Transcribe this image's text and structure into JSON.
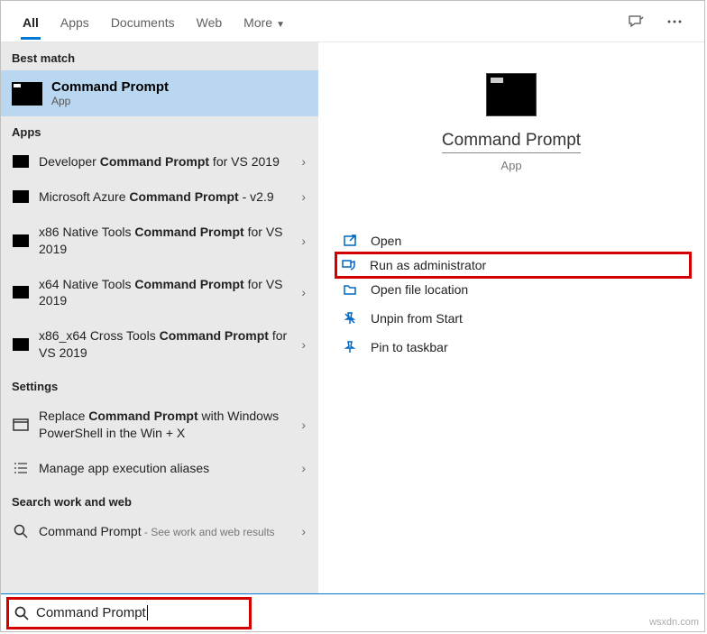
{
  "tabs": {
    "all": "All",
    "apps": "Apps",
    "documents": "Documents",
    "web": "Web",
    "more": "More"
  },
  "sections": {
    "best_match": "Best match",
    "apps": "Apps",
    "settings": "Settings",
    "web": "Search work and web"
  },
  "best_match": {
    "title": "Command Prompt",
    "subtitle": "App"
  },
  "apps_list": [
    {
      "pre": "Developer ",
      "bold": "Command Prompt",
      "post": " for VS 2019"
    },
    {
      "pre": "Microsoft Azure ",
      "bold": "Command Prompt",
      "post": " - v2.9"
    },
    {
      "pre": "x86 Native Tools ",
      "bold": "Command Prompt",
      "post": " for VS 2019"
    },
    {
      "pre": "x64 Native Tools ",
      "bold": "Command Prompt",
      "post": " for VS 2019"
    },
    {
      "pre": "x86_x64 Cross Tools ",
      "bold": "Command Prompt",
      "post": " for VS 2019"
    }
  ],
  "settings_list": [
    {
      "pre": "Replace ",
      "bold": "Command Prompt",
      "post": " with Windows PowerShell in the Win + X"
    },
    {
      "pre": "Manage app execution aliases",
      "bold": "",
      "post": ""
    }
  ],
  "web_list": {
    "title": "Command Prompt",
    "hint": " - See work and web results"
  },
  "detail": {
    "title": "Command Prompt",
    "subtitle": "App"
  },
  "actions": {
    "open": "Open",
    "run_admin": "Run as administrator",
    "open_loc": "Open file location",
    "unpin": "Unpin from Start",
    "pin_tb": "Pin to taskbar"
  },
  "search": {
    "value": "Command Prompt"
  },
  "watermark": "wsxdn.com"
}
